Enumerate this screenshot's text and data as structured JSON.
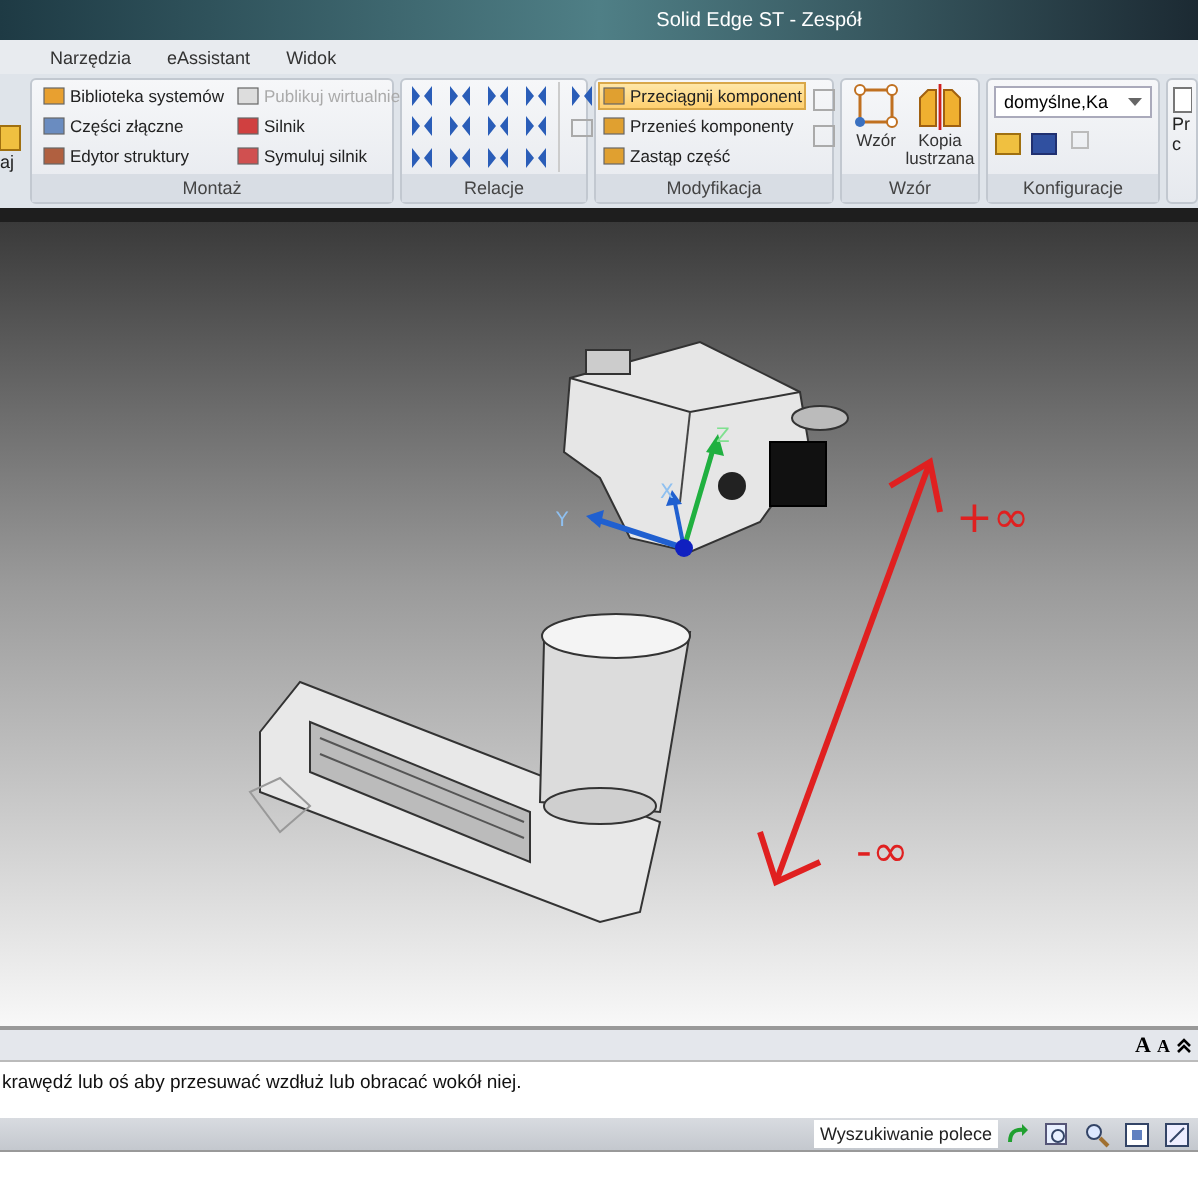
{
  "window": {
    "title": "Solid Edge ST - Zespół"
  },
  "menu_tabs": [
    {
      "label": "Narzędzia",
      "selected": false
    },
    {
      "label": "eAssistant",
      "selected": false
    },
    {
      "label": "Widok",
      "selected": false
    }
  ],
  "ribbon": {
    "cut_left_label": "aj",
    "assembly": {
      "label": "Montaż",
      "columns": [
        [
          {
            "label": "Biblioteka systemów",
            "disabled": false
          },
          {
            "label": "Części złączne",
            "disabled": false
          },
          {
            "label": "Edytor struktury",
            "disabled": false
          }
        ],
        [
          {
            "label": "Publikuj wirtualnie",
            "disabled": true
          },
          {
            "label": "Silnik",
            "disabled": false
          },
          {
            "label": "Symuluj silnik",
            "disabled": false
          }
        ]
      ]
    },
    "relations": {
      "label": "Relacje"
    },
    "modify": {
      "label": "Modyfikacja",
      "items": [
        {
          "label": "Przeciągnij komponent",
          "selected": true
        },
        {
          "label": "Przenieś komponenty",
          "selected": false
        },
        {
          "label": "Zastąp część",
          "selected": false
        }
      ]
    },
    "pattern": {
      "label": "Wzór",
      "buttons": [
        "Wzór",
        "Kopia lustrzana"
      ]
    },
    "configs": {
      "label": "Konfiguracje",
      "dropdown": "domyślne,Ka"
    },
    "cut_group": [
      "Pr",
      "c"
    ]
  },
  "viewport": {
    "axes": [
      "Y",
      "X",
      "Z"
    ],
    "annotations": [
      "+∞",
      "-∞"
    ]
  },
  "command_panel": {
    "font_buttons": [
      "A",
      "A"
    ],
    "prompt": "krawędź lub oś aby przesuwać wzdłuż lub obracać wokół niej."
  },
  "status_bar": {
    "search": {
      "placeholder": "Wyszukiwanie polece"
    }
  }
}
